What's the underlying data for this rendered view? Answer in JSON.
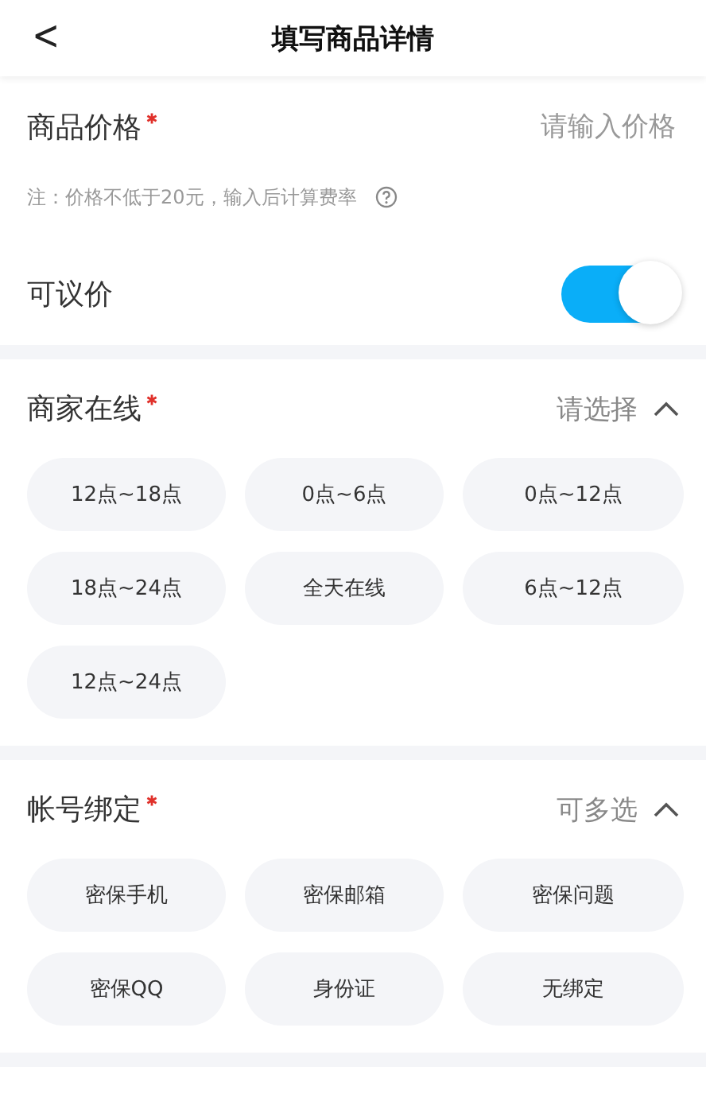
{
  "header": {
    "back": "<",
    "title": "填写商品详情"
  },
  "price": {
    "label": "商品价格",
    "required": true,
    "placeholder": "请输入价格",
    "note": "注：价格不低于20元，输入后计算费率"
  },
  "negotiable": {
    "label": "可议价",
    "on": true
  },
  "groups": [
    {
      "label": "商家在线",
      "required": true,
      "hint": "请选择",
      "expanded": true,
      "options": [
        {
          "label": "12点~18点",
          "selected": false
        },
        {
          "label": "0点~6点",
          "selected": false
        },
        {
          "label": "0点~12点",
          "selected": false
        },
        {
          "label": "18点~24点",
          "selected": false
        },
        {
          "label": "全天在线",
          "selected": false
        },
        {
          "label": "6点~12点",
          "selected": false
        },
        {
          "label": "12点~24点",
          "selected": false
        }
      ]
    },
    {
      "label": "帐号绑定",
      "required": true,
      "hint": "可多选",
      "expanded": true,
      "options": [
        {
          "label": "密保手机",
          "selected": false
        },
        {
          "label": "密保邮箱",
          "selected": false
        },
        {
          "label": "密保问题",
          "selected": false
        },
        {
          "label": "密保QQ",
          "selected": false
        },
        {
          "label": "身份证",
          "selected": false
        },
        {
          "label": "无绑定",
          "selected": false
        }
      ]
    }
  ]
}
